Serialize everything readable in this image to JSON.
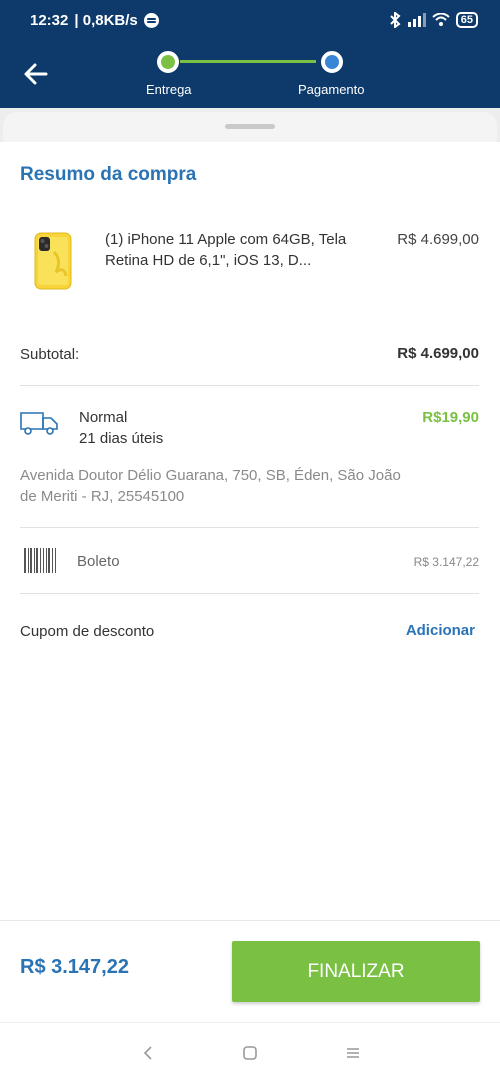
{
  "status_bar": {
    "time": "12:32",
    "net_speed": "| 0,8KB/s",
    "battery": "65"
  },
  "header": {
    "steps": [
      {
        "label": "Entrega",
        "state": "done",
        "color": "#7ac143"
      },
      {
        "label": "Pagamento",
        "state": "current",
        "color": "#3a86d6"
      }
    ],
    "background": "#0d3a6b"
  },
  "summary": {
    "title": "Resumo da compra",
    "product": {
      "name": "(1) iPhone 11 Apple com 64GB, Tela Retina HD de 6,1\", iOS 13, D...",
      "price": "R$ 4.699,00",
      "image_icon": "yellow-iphone"
    },
    "subtotal_label": "Subtotal:",
    "subtotal_value": "R$ 4.699,00",
    "shipping": {
      "icon": "truck-icon",
      "type": "Normal",
      "days": "21 dias úteis",
      "price": "R$19,90",
      "address": "Avenida Doutor Délio Guarana, 750, SB, Éden, São João de Meriti - RJ, 25545100"
    },
    "payment": {
      "icon": "barcode-icon",
      "method": "Boleto",
      "value": "R$ 3.147,22"
    },
    "coupon": {
      "label": "Cupom de desconto",
      "action": "Adicionar"
    }
  },
  "footer": {
    "total": "R$ 3.147,22",
    "button_label": "FINALIZAR",
    "button_color": "#7ac143"
  },
  "colors": {
    "accent_blue": "#2a73b5",
    "accent_green": "#7ac143"
  }
}
